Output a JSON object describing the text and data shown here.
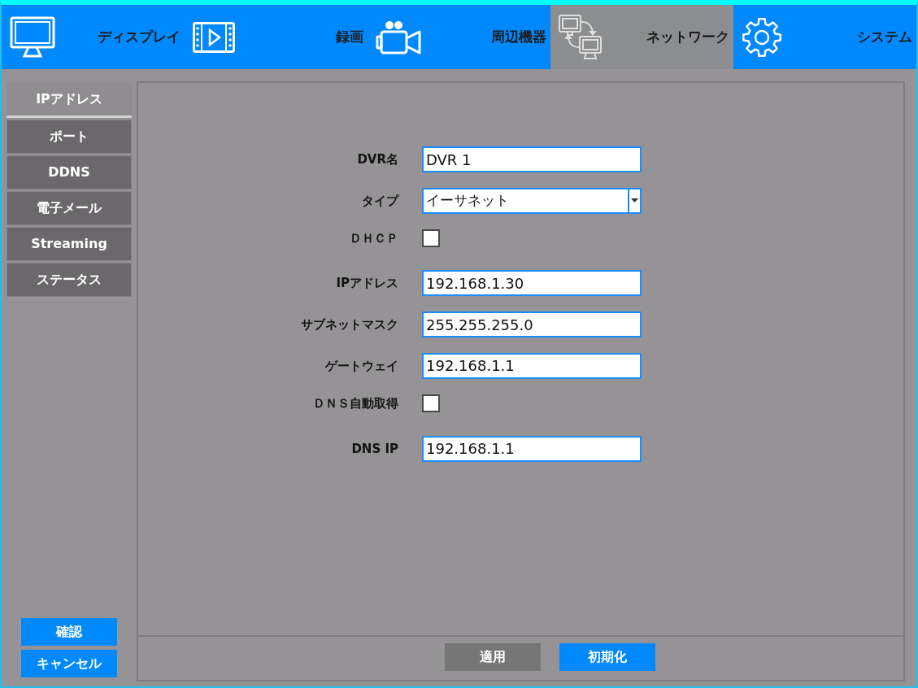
{
  "tabs": [
    {
      "label": "ディスプレイ",
      "selected": false
    },
    {
      "label": "録画",
      "selected": false
    },
    {
      "label": "周辺機器",
      "selected": false
    },
    {
      "label": "ネットワーク",
      "selected": true
    },
    {
      "label": "システム",
      "selected": false
    }
  ],
  "sidebar": {
    "items": [
      {
        "label": "IPアドレス",
        "selected": true
      },
      {
        "label": "ポート",
        "selected": false
      },
      {
        "label": "DDNS",
        "selected": false
      },
      {
        "label": "電子メール",
        "selected": false
      },
      {
        "label": "Streaming",
        "selected": false
      },
      {
        "label": "ステータス",
        "selected": false
      }
    ],
    "buttons": [
      "確認",
      "キャンセル"
    ]
  },
  "form": {
    "fields": [
      {
        "kind": "text",
        "label": "DVR名",
        "value": "DVR 1"
      },
      {
        "kind": "select",
        "label": "タイプ",
        "value": "イーサネット"
      },
      {
        "kind": "checkbox",
        "label": "ＤＨＣＰ",
        "checked": false
      },
      {
        "kind": "text",
        "label": "IPアドレス",
        "value": "192.168.1.30"
      },
      {
        "kind": "text",
        "label": "サブネットマスク",
        "value": "255.255.255.0"
      },
      {
        "kind": "text",
        "label": "ゲートウェイ",
        "value": "192.168.1.1"
      },
      {
        "kind": "checkbox",
        "label": "ＤＮＳ自動取得",
        "checked": false
      },
      {
        "kind": "text",
        "label": "DNS IP",
        "value": "192.168.1.1"
      }
    ],
    "buttons": [
      {
        "label": "適用",
        "disabled": true
      },
      {
        "label": "初期化",
        "disabled": false
      }
    ]
  }
}
